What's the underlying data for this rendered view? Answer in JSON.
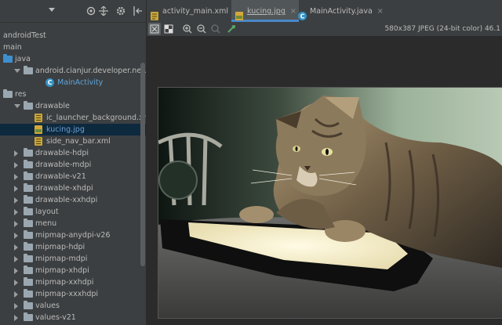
{
  "project_panel": {
    "toolbar_icons": [
      "dropdown-arrow-icon",
      "target-icon",
      "collapse-icon",
      "gear-icon",
      "hide-icon"
    ],
    "tree": [
      {
        "label": "androidTest",
        "indent": 0,
        "kind": "text",
        "arrow": "none"
      },
      {
        "label": "main",
        "indent": 0,
        "kind": "text",
        "arrow": "none"
      },
      {
        "label": "java",
        "indent": 0,
        "kind": "folder-blue",
        "arrow": "none"
      },
      {
        "label": "android.cianjur.developer.net.basicand",
        "indent": 1,
        "kind": "package",
        "arrow": "down"
      },
      {
        "label": "MainActivity",
        "indent": 3,
        "kind": "class",
        "arrow": "none",
        "color": "#5fa3d8"
      },
      {
        "label": "res",
        "indent": 0,
        "kind": "folder-grey",
        "arrow": "none"
      },
      {
        "label": "drawable",
        "indent": 1,
        "kind": "folder-grey",
        "arrow": "down"
      },
      {
        "label": "ic_launcher_background.xml",
        "indent": 2,
        "kind": "xml",
        "arrow": "none"
      },
      {
        "label": "kucing.jpg",
        "indent": 2,
        "kind": "image",
        "arrow": "none",
        "selected": true,
        "color": "#6f9fd6"
      },
      {
        "label": "side_nav_bar.xml",
        "indent": 2,
        "kind": "xml",
        "arrow": "none"
      },
      {
        "label": "drawable-hdpi",
        "indent": 1,
        "kind": "folder-grey",
        "arrow": "right"
      },
      {
        "label": "drawable-mdpi",
        "indent": 1,
        "kind": "folder-grey",
        "arrow": "right"
      },
      {
        "label": "drawable-v21",
        "indent": 1,
        "kind": "folder-grey",
        "arrow": "right"
      },
      {
        "label": "drawable-xhdpi",
        "indent": 1,
        "kind": "folder-grey",
        "arrow": "right"
      },
      {
        "label": "drawable-xxhdpi",
        "indent": 1,
        "kind": "folder-grey",
        "arrow": "right"
      },
      {
        "label": "layout",
        "indent": 1,
        "kind": "folder-grey",
        "arrow": "right"
      },
      {
        "label": "menu",
        "indent": 1,
        "kind": "folder-grey",
        "arrow": "right"
      },
      {
        "label": "mipmap-anydpi-v26",
        "indent": 1,
        "kind": "folder-grey",
        "arrow": "right"
      },
      {
        "label": "mipmap-hdpi",
        "indent": 1,
        "kind": "folder-grey",
        "arrow": "right"
      },
      {
        "label": "mipmap-mdpi",
        "indent": 1,
        "kind": "folder-grey",
        "arrow": "right"
      },
      {
        "label": "mipmap-xhdpi",
        "indent": 1,
        "kind": "folder-grey",
        "arrow": "right"
      },
      {
        "label": "mipmap-xxhdpi",
        "indent": 1,
        "kind": "folder-grey",
        "arrow": "right"
      },
      {
        "label": "mipmap-xxxhdpi",
        "indent": 1,
        "kind": "folder-grey",
        "arrow": "right"
      },
      {
        "label": "values",
        "indent": 1,
        "kind": "folder-grey",
        "arrow": "right"
      },
      {
        "label": "values-v21",
        "indent": 1,
        "kind": "folder-grey",
        "arrow": "right"
      }
    ]
  },
  "editor": {
    "tabs": [
      {
        "label": "activity_main.xml",
        "icon": "xml-file-icon",
        "close": "×",
        "active": false
      },
      {
        "label": "kucing.jpg",
        "icon": "image-file-icon",
        "close": "×",
        "active": true
      },
      {
        "label": "MainActivity.java",
        "icon": "class-file-icon",
        "close": "×",
        "active": false
      }
    ],
    "image_toolbar": {
      "buttons": [
        "grid-toggle-icon",
        "chessboard-icon",
        "zoom-in-icon",
        "zoom-out-icon",
        "actual-size-icon",
        "color-picker-icon"
      ],
      "info": "580x387 JPEG (24-bit color) 46.1"
    },
    "image": {
      "subject": "cat-on-tablet-photo"
    }
  },
  "colors": {
    "selection": "#0d293e",
    "accent_tab": "#4a88c7",
    "class_icon": "#3592c4"
  }
}
